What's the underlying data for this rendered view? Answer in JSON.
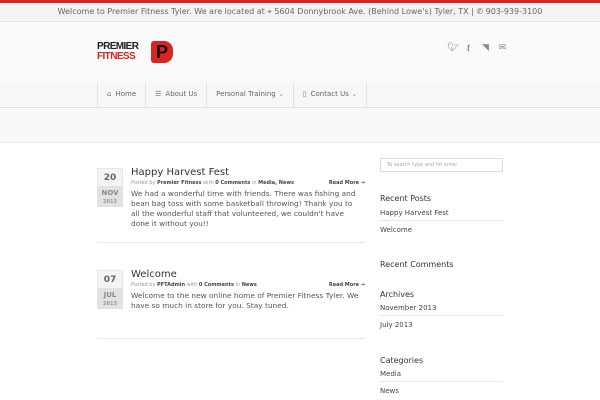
{
  "topbar": {
    "text": "Welcome to Premier Fitness Tyler. We are located at",
    "address": "5604 Donnybrook Ave. (Behind Lowe's) Tyler, TX |",
    "phone": "903-939-3100"
  },
  "logo": {
    "line1": "PREMIER",
    "line2": "FITNESS",
    "badge": "P"
  },
  "social": [
    "twitter-icon",
    "facebook-icon",
    "rss-icon",
    "email-icon"
  ],
  "nav": {
    "items": [
      {
        "label": "Home",
        "icon": "home-icon"
      },
      {
        "label": "About Us",
        "icon": "list-icon"
      },
      {
        "label": "Personal Training",
        "dropdown": true
      },
      {
        "label": "Contact Us",
        "icon": "phone-icon",
        "dropdown": true
      }
    ]
  },
  "posts": [
    {
      "day": "20",
      "month": "NOV",
      "year": "2013",
      "title": "Happy Harvest Fest",
      "posted_by": "Posted by",
      "author": "Premier Fitness",
      "with": "with",
      "comments": "0 Comments",
      "in": "in",
      "categories": "Media, News",
      "read_more": "Read More →",
      "excerpt": "We had a wonderful time with friends. There was fishing and bean bag toss with some basketball throwing! Thank you to all the wonderful staff that volunteered, we couldn't have done it without you!!"
    },
    {
      "day": "07",
      "month": "JUL",
      "year": "2013",
      "title": "Welcome",
      "posted_by": "Posted by",
      "author": "PFTAdmin",
      "with": "with",
      "comments": "0 Comments",
      "in": "in",
      "categories": "News",
      "read_more": "Read More →",
      "excerpt": "Welcome to the new online home of Premier Fitness Tyler. We have so much in store for you. Stay tuned."
    }
  ],
  "sidebar": {
    "search_placeholder": "To search type and hit enter",
    "recent_posts_title": "Recent Posts",
    "recent_posts": [
      "Happy Harvest Fest",
      "Welcome"
    ],
    "recent_comments_title": "Recent Comments",
    "archives_title": "Archives",
    "archives": [
      "November 2013",
      "July 2013"
    ],
    "categories_title": "Categories",
    "categories": [
      "Media",
      "News"
    ]
  }
}
